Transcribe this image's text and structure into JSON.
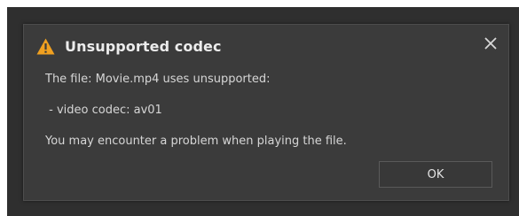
{
  "dialog": {
    "title": "Unsupported codec",
    "title_icon": "warning-triangle-icon",
    "close_icon": "close-x-icon",
    "message_line1": "The file: Movie.mp4 uses unsupported:",
    "message_line2": " - video codec: av01",
    "message_line3": "You may encounter a problem when playing the file.",
    "ok_label": "OK"
  },
  "colors": {
    "warning": "#f0a020",
    "dialog_bg": "#3b3b3b",
    "backdrop": "#2f2f2f"
  }
}
